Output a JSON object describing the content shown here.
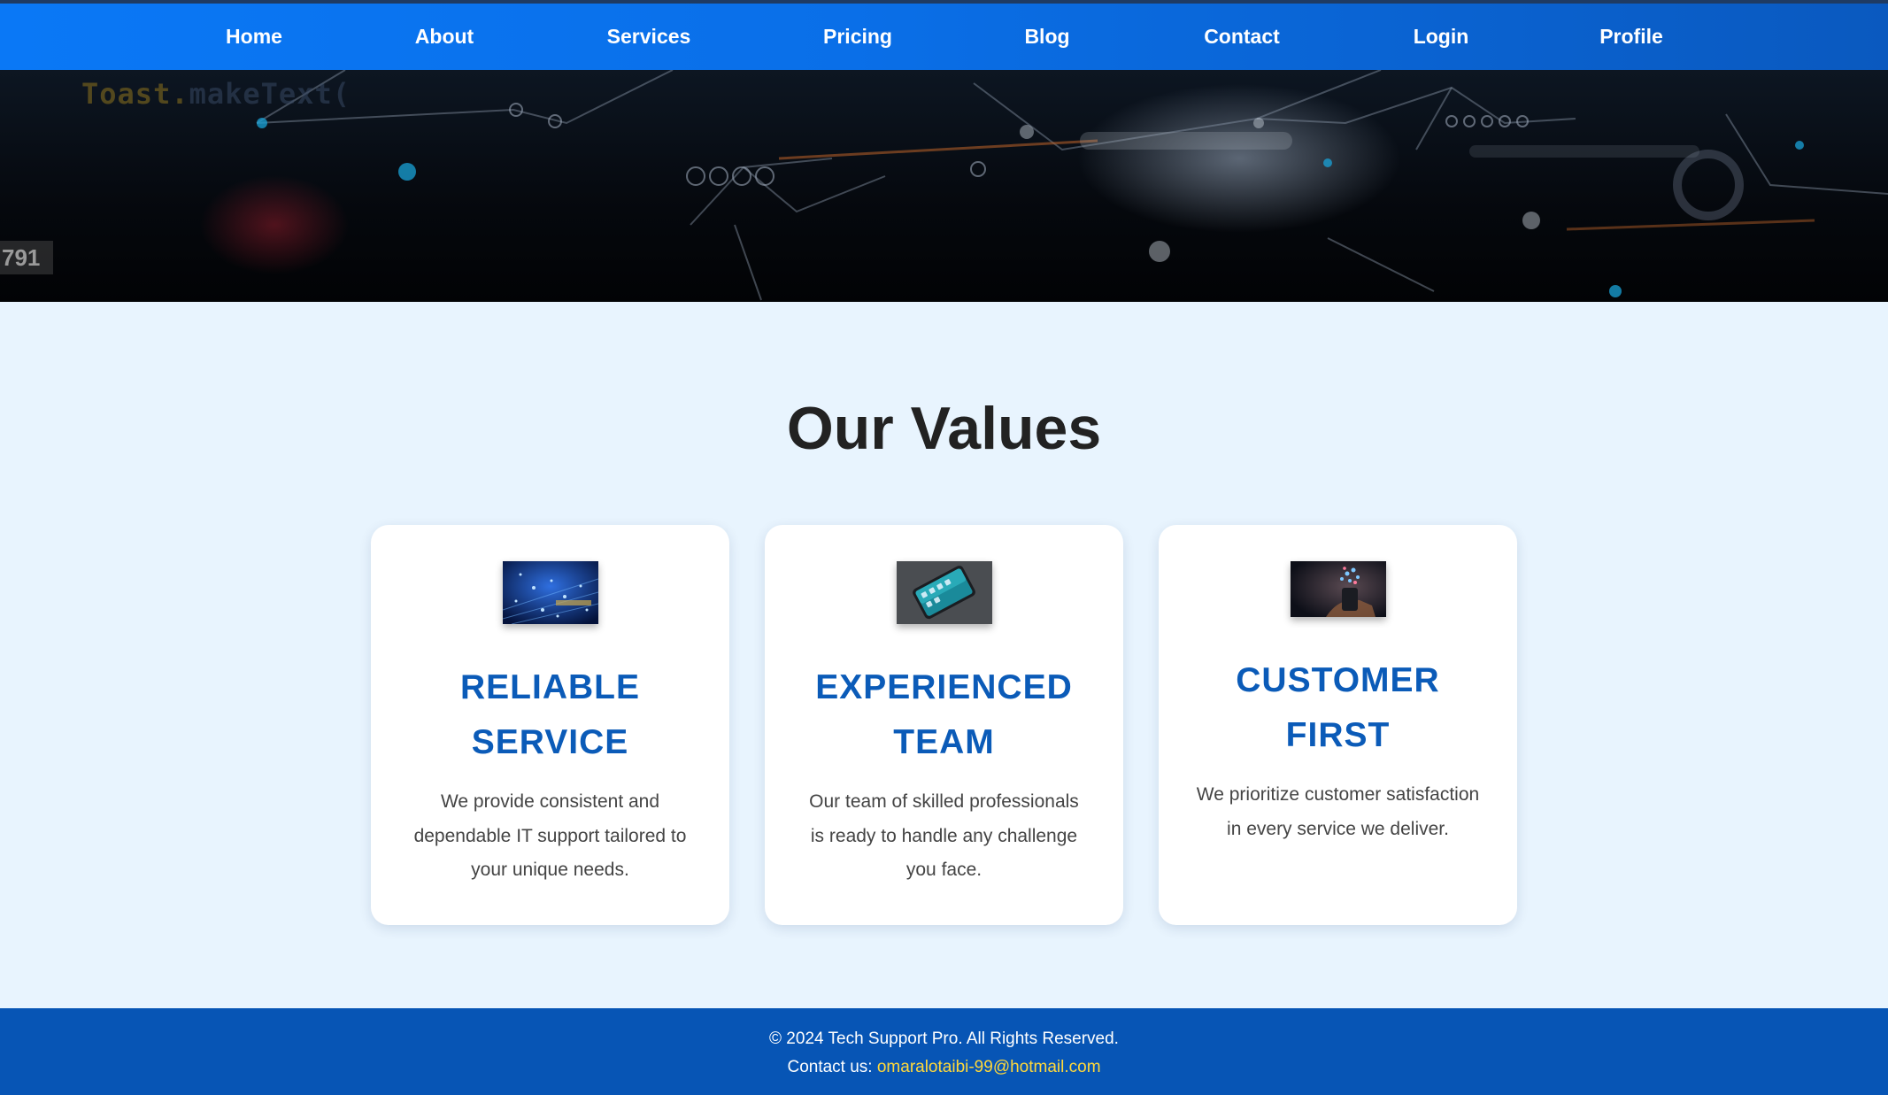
{
  "nav": {
    "items": [
      {
        "label": "Home"
      },
      {
        "label": "About"
      },
      {
        "label": "Services"
      },
      {
        "label": "Pricing"
      },
      {
        "label": "Blog"
      },
      {
        "label": "Contact"
      },
      {
        "label": "Login"
      },
      {
        "label": "Profile"
      }
    ]
  },
  "hero": {
    "code_text": "Toast.",
    "code_text_faded": "makeText(",
    "counter_text": "791"
  },
  "values": {
    "title": "Our Values",
    "cards": [
      {
        "title_line1": "RELIABLE",
        "title_line2": "SERVICE",
        "text": "We provide consistent and dependable IT support tailored to your unique needs.",
        "image_icon": "network-lights-image"
      },
      {
        "title_line1": "EXPERIENCED",
        "title_line2": "TEAM",
        "text": "Our team of skilled professionals is ready to handle any challenge you face.",
        "image_icon": "smartphone-image"
      },
      {
        "title_line1": "CUSTOMER",
        "title_line2": "FIRST",
        "text": "We prioritize customer satisfaction in every service we deliver.",
        "image_icon": "hand-holding-phone-image"
      }
    ]
  },
  "footer": {
    "copyright": "© 2024 Tech Support Pro. All Rights Reserved.",
    "contact_label": "Contact us:",
    "email": "omaralotaibi-99@hotmail.com"
  },
  "colors": {
    "nav_blue": "#0a78f6",
    "heading_blue": "#0b5bb8",
    "footer_blue": "#0755b5",
    "email_yellow": "#ffd83a",
    "page_background": "#e8f4fe"
  }
}
